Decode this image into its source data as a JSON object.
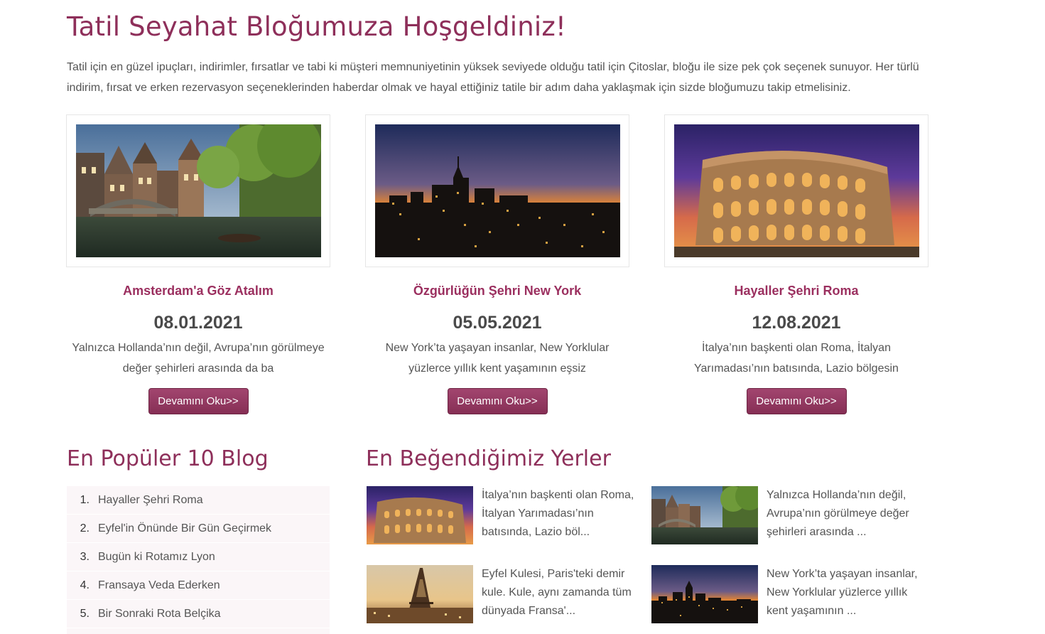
{
  "header": {
    "title": "Tatil Seyahat Bloğumuza Hoşgeldiniz!",
    "intro": "Tatil için en güzel ipuçları, indirimler, fırsatlar ve tabi ki müşteri memnuniyetinin yüksek seviyede olduğu tatil için Çitoslar, bloğu ile size pek çok seçenek sunuyor. Her türlü indirim, fırsat ve erken rezervasyon seçeneklerinden haberdar olmak ve hayal ettiğiniz tatile bir adım daha yaklaşmak için sizde bloğumuzu takip etmelisiniz."
  },
  "cards": [
    {
      "title": "Amsterdam'a Göz Atalım",
      "date": "08.01.2021",
      "excerpt": "Yalnızca Hollanda’nın değil, Avrupa’nın görülmeye değer şehirleri arasında da ba",
      "button": "Devamını Oku>>"
    },
    {
      "title": "Özgürlüğün Şehri New York",
      "date": "05.05.2021",
      "excerpt": "New York’ta yaşayan insanlar, New Yorklular yüzlerce yıllık kent yaşamının eşsiz",
      "button": "Devamını Oku>>"
    },
    {
      "title": "Hayaller Şehri Roma",
      "date": "12.08.2021",
      "excerpt": "İtalya’nın başkenti olan Roma, İtalyan Yarımadası’nın batısında, Lazio bölgesin",
      "button": "Devamını Oku>>"
    }
  ],
  "popular": {
    "title": "En Popüler 10 Blog",
    "items": [
      {
        "num": "1.",
        "label": "Hayaller Şehri Roma"
      },
      {
        "num": "2.",
        "label": "Eyfel'in Önünde Bir Gün Geçirmek"
      },
      {
        "num": "3.",
        "label": "Bugün ki Rotamız Lyon"
      },
      {
        "num": "4.",
        "label": "Fransaya Veda Ederken"
      },
      {
        "num": "5.",
        "label": "Bir Sonraki Rota Belçika"
      }
    ]
  },
  "favorites": {
    "title": "En Beğendiğimiz Yerler",
    "items": [
      {
        "text": "İtalya’nın başkenti olan Roma, İtalyan Yarımadası’nın batısında, Lazio böl..."
      },
      {
        "text": "Yalnızca Hollanda’nın değil, Avrupa’nın görülmeye değer şehirleri arasında ..."
      },
      {
        "text": "Eyfel Kulesi, Paris'teki demir kule. Kule, aynı zamanda tüm dünyada Fransa'..."
      },
      {
        "text": "New York’ta yaşayan insanlar, New Yorklular yüzlerce yıllık kent yaşamının ..."
      }
    ]
  },
  "colors": {
    "accent": "#8e2f5a",
    "button": "#9b3a66",
    "text": "#555555"
  }
}
